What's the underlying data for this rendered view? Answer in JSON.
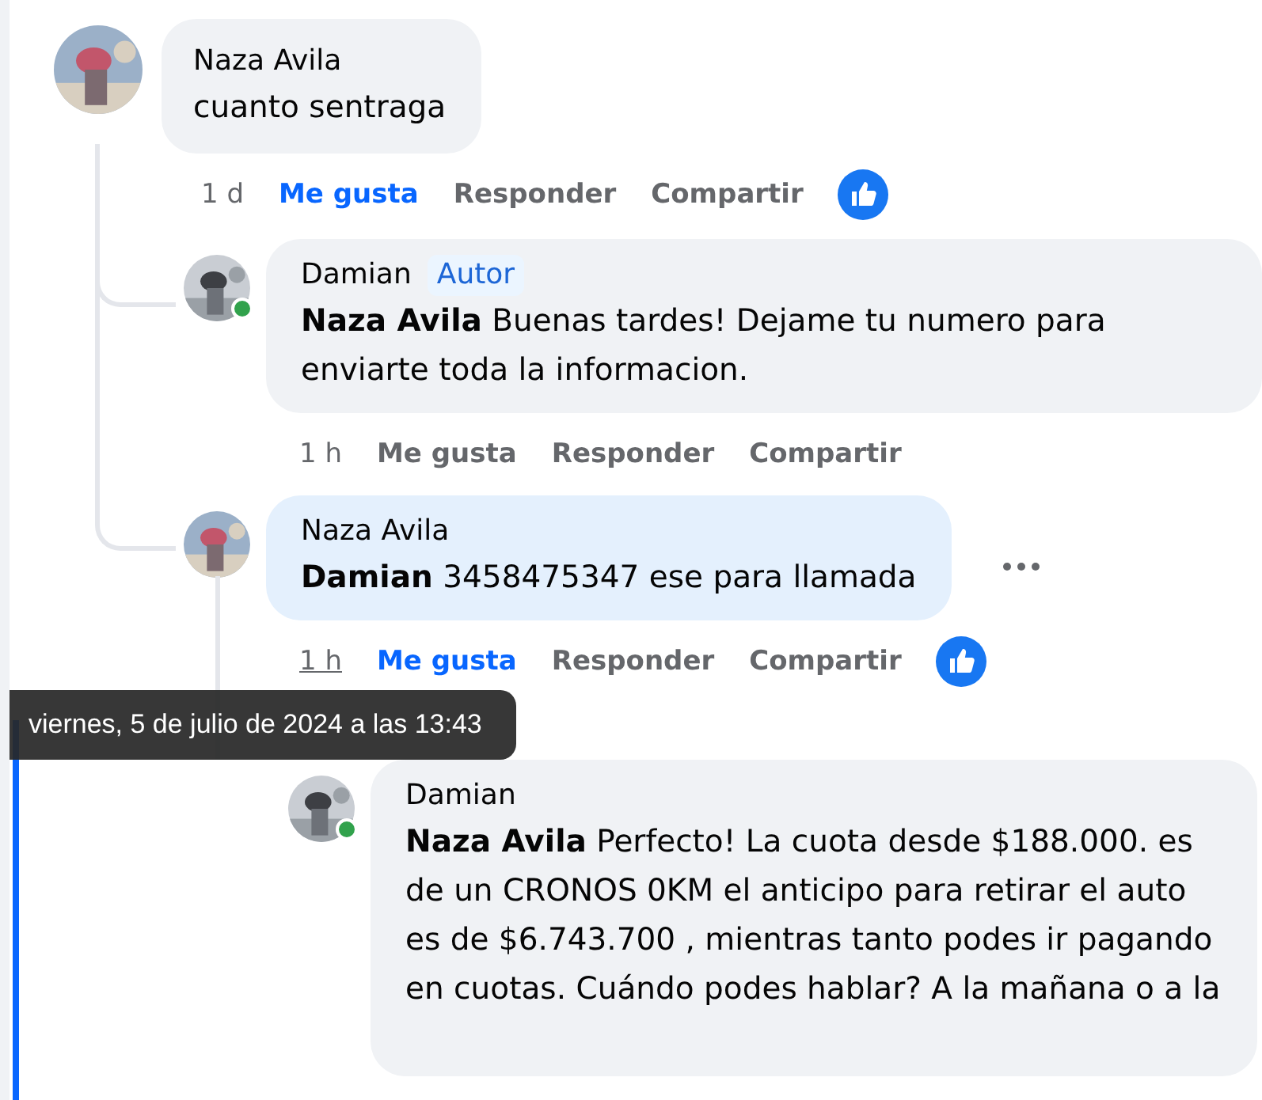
{
  "comments": [
    {
      "author": "Naza Avila",
      "text": "cuanto sentraga",
      "highlighted": false,
      "time": "1 d",
      "time_underlined": false,
      "like_icon": true,
      "actions": [
        {
          "label": "Me gusta",
          "selected": true
        },
        {
          "label": "Responder",
          "selected": false
        },
        {
          "label": "Compartir",
          "selected": false
        }
      ],
      "replies": [
        {
          "author": "Damian",
          "badge": "Autor",
          "mention": "Naza Avila",
          "text": "Buenas tardes! Dejame tu numero para enviarte toda la informacion.",
          "online": true,
          "highlighted": false,
          "time": "1 h",
          "time_underlined": false,
          "actions": [
            {
              "label": "Me gusta",
              "selected": false
            },
            {
              "label": "Responder",
              "selected": false
            },
            {
              "label": "Compartir",
              "selected": false
            }
          ]
        },
        {
          "author": "Naza Avila",
          "mention": "Damian",
          "text": "3458475347 ese para llamada",
          "highlighted": true,
          "more_menu": true,
          "time": "1 h",
          "time_underlined": true,
          "like_icon": true,
          "actions": [
            {
              "label": "Me gusta",
              "selected": true
            },
            {
              "label": "Responder",
              "selected": false
            },
            {
              "label": "Compartir",
              "selected": false
            }
          ],
          "replies": [
            {
              "author": "Damian",
              "mention": "Naza Avila",
              "text": "Perfecto! La cuota desde $188.000. es de un CRONOS 0KM el anticipo para retirar el auto es de $6.743.700 , mientras tanto podes ir pagando en cuotas. Cuándo podes hablar? A la mañana o a la",
              "online": true,
              "highlighted": false
            }
          ]
        }
      ]
    }
  ],
  "tooltip": {
    "text": "viernes, 5 de julio de 2024 a las 13:43"
  }
}
